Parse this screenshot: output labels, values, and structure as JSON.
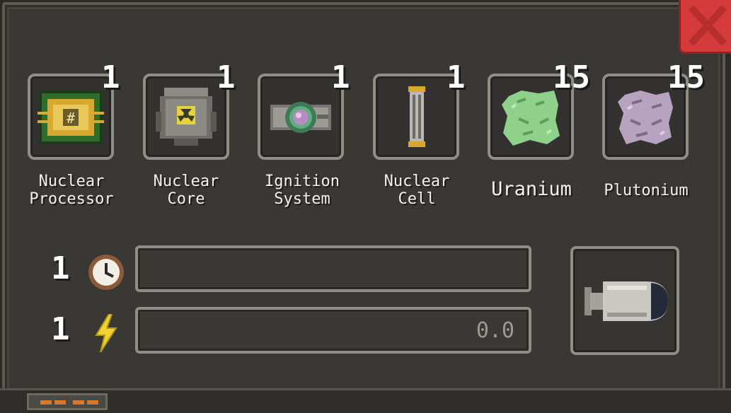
{
  "items": [
    {
      "count": "1",
      "label": "Nuclear\nProcessor",
      "icon": "nuclear-processor-icon"
    },
    {
      "count": "1",
      "label": "Nuclear\nCore",
      "icon": "nuclear-core-icon"
    },
    {
      "count": "1",
      "label": "Ignition\nSystem",
      "icon": "ignition-system-icon"
    },
    {
      "count": "1",
      "label": "Nuclear\nCell",
      "icon": "nuclear-cell-icon"
    },
    {
      "count": "15",
      "label": "Uranium",
      "icon": "uranium-icon"
    },
    {
      "count": "15",
      "label": "Plutonium",
      "icon": "plutonium-icon"
    }
  ],
  "stats": {
    "time_count": "1",
    "energy_count": "1",
    "energy_value": "0.0",
    "time_progress": 0,
    "energy_progress": 0
  },
  "output": {
    "icon": "nuclear-bomb-icon"
  },
  "colors": {
    "close": "#d63b3b",
    "energy": "#f2d233"
  }
}
